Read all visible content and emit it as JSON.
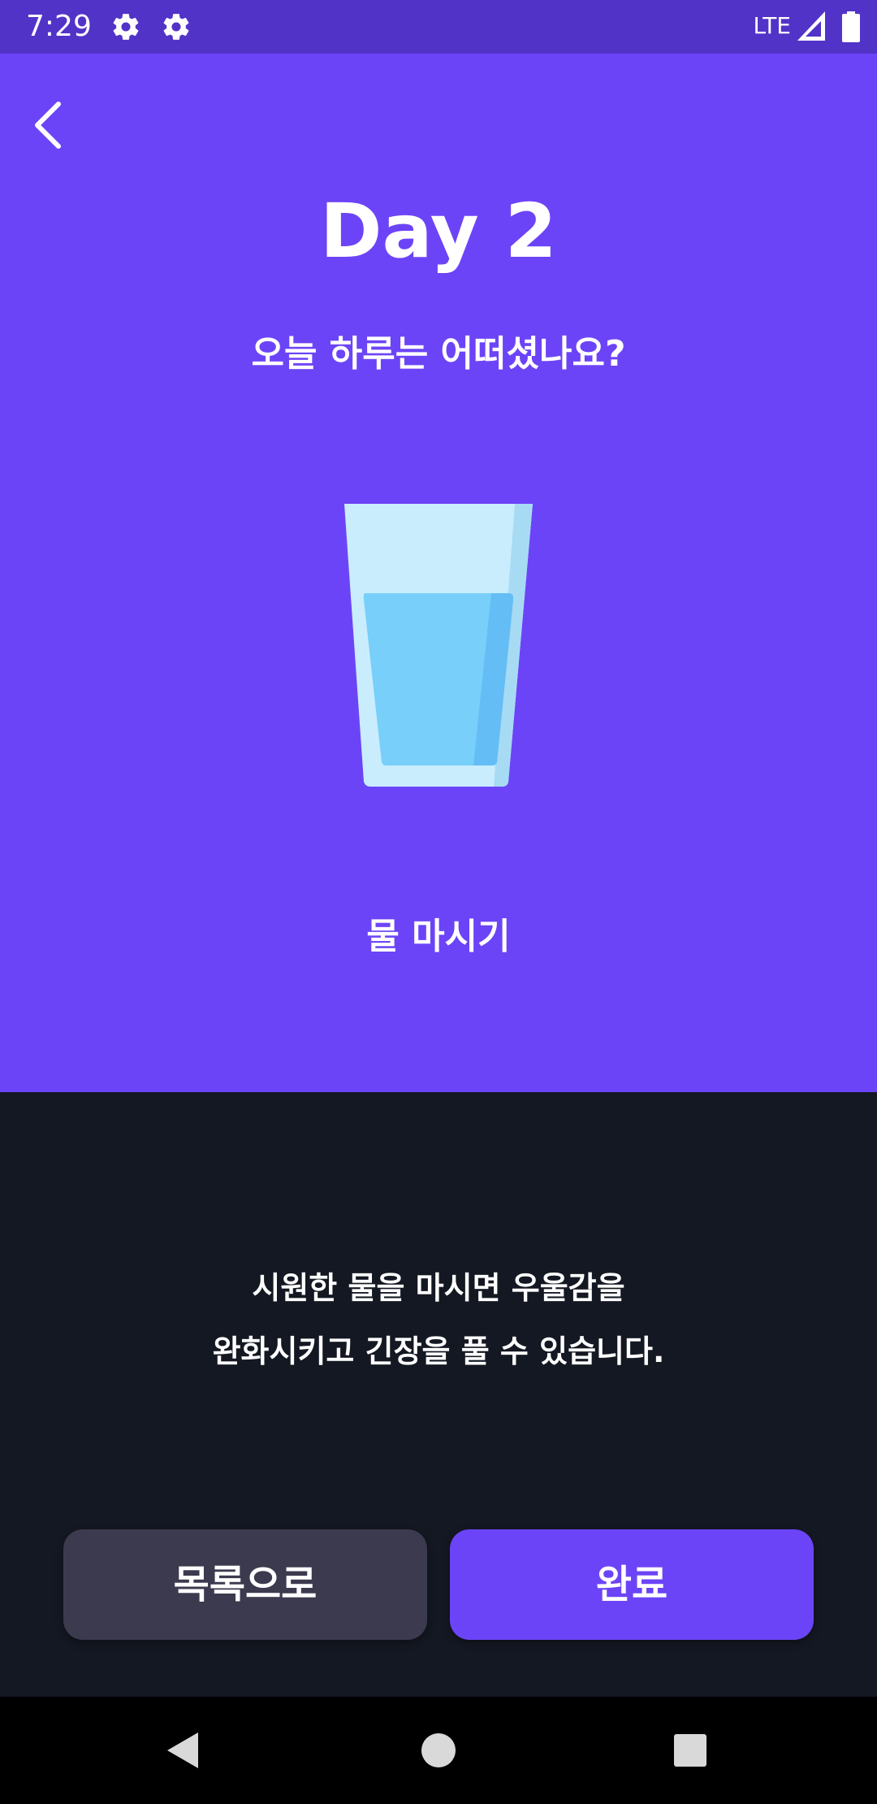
{
  "status_bar": {
    "time": "7:29",
    "network": "LTE",
    "icons": [
      "gear-icon",
      "gear-icon",
      "signal-icon",
      "battery-icon"
    ]
  },
  "header": {
    "back_icon": "chevron-left-icon",
    "title": "Day 2",
    "question": "오늘 하루는 어떠셨나요?"
  },
  "activity": {
    "icon": "water-glass-icon",
    "label": "물 마시기"
  },
  "description": {
    "lines": [
      "시원한 물을 마시면 우울감을",
      "완화시키고 긴장을 풀 수 있습니다."
    ]
  },
  "buttons": {
    "list_label": "목록으로",
    "done_label": "완료"
  },
  "nav": {
    "icons": [
      "back-triangle-icon",
      "home-circle-icon",
      "recents-square-icon"
    ]
  },
  "colors": {
    "accent": "#6C44F7",
    "status_bar": "#5233C8",
    "background_dark": "#141822",
    "secondary_button": "#3C3A4E"
  }
}
